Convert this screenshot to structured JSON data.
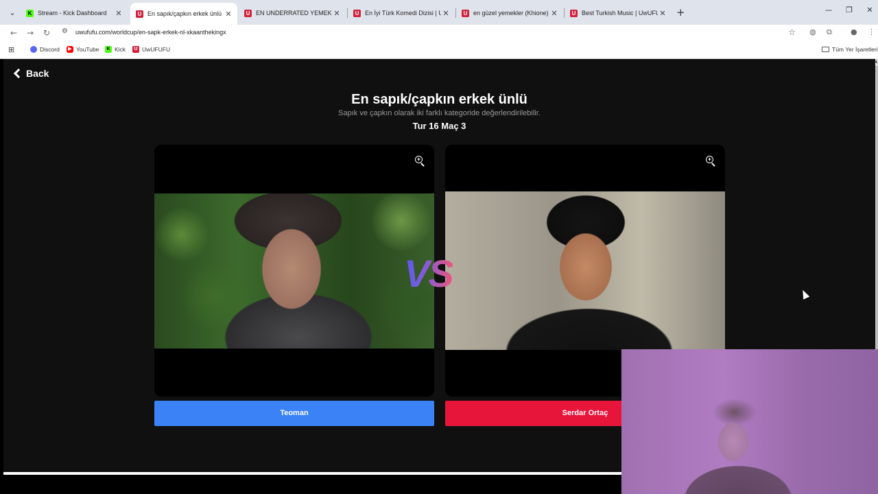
{
  "browser": {
    "tabs": [
      {
        "label": "Stream - Kick Dashboard",
        "icon": "kick-icon",
        "active": false
      },
      {
        "label": "En sapık/çapkın erkek ünlü | Uw",
        "icon": "uwufufu-icon",
        "active": true
      },
      {
        "label": "EN UNDERRATED YEMEK | UwU",
        "icon": "uwufufu-icon",
        "active": false
      },
      {
        "label": "En İyi Türk Komedi Dizisi | UwU",
        "icon": "uwufufu-icon",
        "active": false
      },
      {
        "label": "en güzel yemekler (Khione) | Uw",
        "icon": "uwufufu-icon",
        "active": false
      },
      {
        "label": "Best Turkish Music | UwUFUFU",
        "icon": "uwufufu-icon",
        "active": false
      }
    ],
    "url": "uwufufu.com/worldcup/en-sapk-erkek-nl-xkaanthekingx",
    "bookmarks": [
      {
        "label": "Discord",
        "icon": "discord-icon"
      },
      {
        "label": "YouTube",
        "icon": "youtube-icon"
      },
      {
        "label": "Kick",
        "icon": "kick-icon"
      },
      {
        "label": "UwUFUFU",
        "icon": "uwufufu-icon"
      }
    ],
    "bookmarks_folder": "Tüm Yer İşaretleri"
  },
  "page": {
    "back_label": "Back",
    "title": "En sapık/çapkın erkek ünlü",
    "subtitle": "Sapık ve çapkın olarak iki farklı kategoride değerlendirilebilir.",
    "round": "Tur 16 Maç 3",
    "vs_label": "VS",
    "left_choice": "Teoman",
    "right_choice": "Serdar Ortaç"
  },
  "colors": {
    "left_button": "#3b82f6",
    "right_button": "#e8153a",
    "page_bg": "#101010"
  }
}
